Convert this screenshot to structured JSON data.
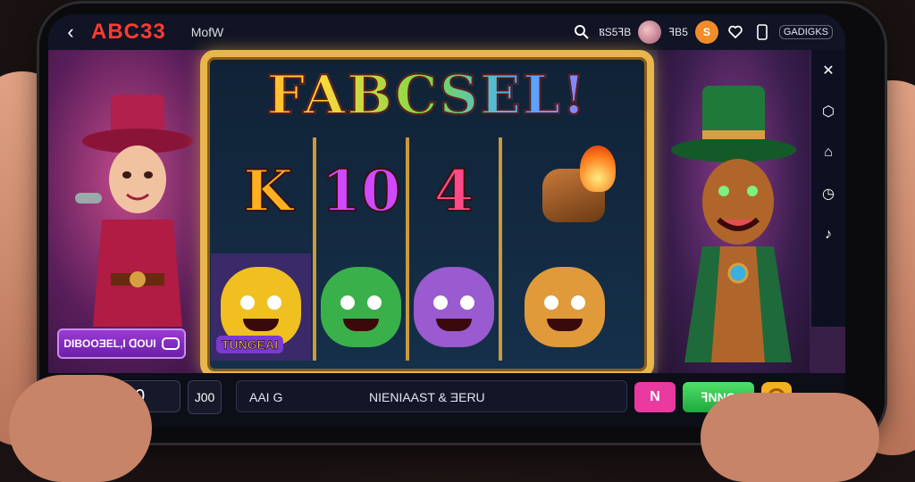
{
  "header": {
    "back_icon": "arrow-left-icon",
    "logo": "ABC33",
    "mode": "MofW",
    "search_icon": "search-icon",
    "stat_1": "ⲂS5ꟻB",
    "avatar_icon": "avatar",
    "stat_2": "ꟻB5",
    "coin_label": "S",
    "heart_icon": "heart-icon",
    "phone_icon": "phone-icon",
    "account": "GADIGKS"
  },
  "game": {
    "title": "FABCSEL!",
    "reel_symbols": [
      "K",
      "10",
      "4"
    ],
    "bonus_symbol_label": "TUNGEAI",
    "promo_label": "DIBOOƎEL,I ꓷOUI"
  },
  "toolbar": [
    "close-icon",
    "shield-icon",
    "home-icon",
    "clock-icon",
    "sound-icon"
  ],
  "footer": {
    "home_icon": "home-icon",
    "currency": "$",
    "balance": "390",
    "bet": "J00",
    "message_left": "AAI G",
    "message_center": "NIENIAAST & ƎERU",
    "pink_button": "N",
    "spin_button": "ꟻNNG",
    "settings_icon": "settings-icon"
  },
  "colors": {
    "accent_red": "#e01f2c",
    "accent_green": "#2fbf4a",
    "accent_gold": "#f3b21f",
    "accent_pink": "#e83aa0",
    "accent_purple": "#8a3ad6"
  }
}
